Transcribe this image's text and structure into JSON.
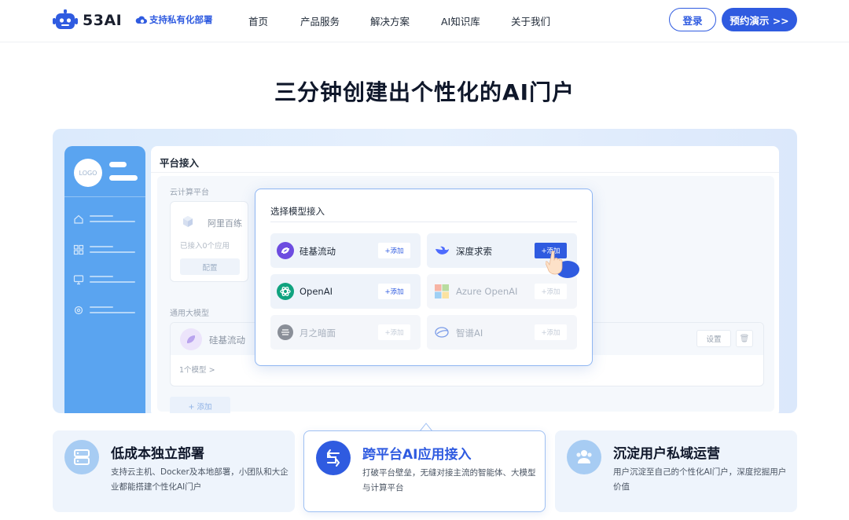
{
  "header": {
    "brand": "53AI",
    "tagline": "支持私有化部署",
    "nav": [
      "首页",
      "产品服务",
      "解决方案",
      "AI知识库",
      "关于我们"
    ],
    "login_label": "登录",
    "demo_label": "预约演示 >>"
  },
  "hero": {
    "title": "三分钟创建出个性化的AI门户"
  },
  "mock": {
    "sidebar": {
      "logo_text": "LOGO",
      "icons": [
        "home-icon",
        "grid-icon",
        "monitor-icon",
        "settings-icon"
      ]
    },
    "panel": {
      "title": "平台接入",
      "cloud_section": "云计算平台",
      "aliyun": {
        "name": "阿里百练",
        "sub": "已接入0个应用",
        "config": "配置"
      },
      "general_section": "通用大模型",
      "siliconflow": {
        "name": "硅基流动",
        "models": "1个模型  >",
        "settings": "设置",
        "delete_icon": "🗑"
      },
      "add_label": "+ 添加"
    },
    "modal": {
      "title": "选择模型接入",
      "items": [
        {
          "name": "硅基流动",
          "add": "+添加",
          "icon": "siliconflow-icon",
          "state": "active"
        },
        {
          "name": "深度求索",
          "add": "+添加",
          "icon": "deepseek-icon",
          "state": "selected"
        },
        {
          "name": "OpenAI",
          "add": "+添加",
          "icon": "openai-icon",
          "state": "active"
        },
        {
          "name": "Azure OpenAI",
          "add": "+添加",
          "icon": "azure-icon",
          "state": "disabled"
        },
        {
          "name": "月之暗面",
          "add": "+添加",
          "icon": "moonshot-icon",
          "state": "disabled"
        },
        {
          "name": "智谱AI",
          "add": "+添加",
          "icon": "zhipu-icon",
          "state": "disabled"
        }
      ]
    }
  },
  "features": [
    {
      "title": "低成本独立部署",
      "desc": "支持云主机、Docker及本地部署，小团队和大企业都能搭建个性化AI门户",
      "icon": "server-icon"
    },
    {
      "title": "跨平台AI应用接入",
      "desc": "打破平台壁垒，无缝对接主流的智能体、大模型与计算平台",
      "icon": "platform-link-icon"
    },
    {
      "title": "沉淀用户私域运营",
      "desc": "用户沉淀至自己的个性化AI门户，深度挖掘用户价值",
      "icon": "users-icon"
    }
  ],
  "colors": {
    "accent": "#2f5be0",
    "sidebar": "#5aa4f0",
    "showcase_bg": "#dbeafc"
  }
}
